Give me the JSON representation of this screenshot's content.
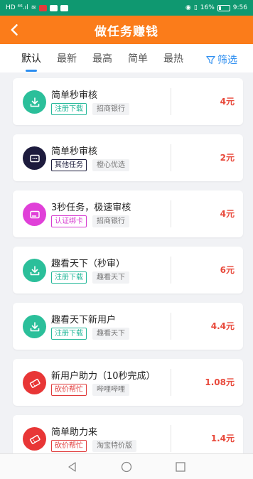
{
  "status_bar": {
    "left_text": "HD ⁴⁶.ıl",
    "battery_percent": "16%",
    "time": "9:56"
  },
  "header": {
    "back_icon": "chevron-left-icon",
    "title": "做任务赚钱"
  },
  "tabs": [
    {
      "label": "默认",
      "active": true
    },
    {
      "label": "最新",
      "active": false
    },
    {
      "label": "最高",
      "active": false
    },
    {
      "label": "简单",
      "active": false
    },
    {
      "label": "最热",
      "active": false
    }
  ],
  "filter": {
    "label": "筛选",
    "icon": "filter-icon"
  },
  "tasks": [
    {
      "title": "简单秒审核",
      "tag": "注册下载",
      "tag_color": "#25b89a",
      "source": "招商银行",
      "price": "4元",
      "icon": "download-icon",
      "icon_bg": "#2bbf9a"
    },
    {
      "title": "简单秒审核",
      "tag": "其他任务",
      "tag_color": "#1a1a3a",
      "source": "橙心优选",
      "price": "2元",
      "icon": "message-icon",
      "icon_bg": "#1d1b3d"
    },
    {
      "title": "3秒任务，极速审核",
      "tag": "认证绑卡",
      "tag_color": "#d63bd0",
      "source": "招商银行",
      "price": "4元",
      "icon": "card-icon",
      "icon_bg": "#e040d8"
    },
    {
      "title": "趣看天下（秒审）",
      "tag": "注册下载",
      "tag_color": "#25b89a",
      "source": "趣看天下",
      "price": "6元",
      "icon": "download-icon",
      "icon_bg": "#2bbf9a"
    },
    {
      "title": "趣看天下新用户",
      "tag": "注册下载",
      "tag_color": "#25b89a",
      "source": "趣看天下",
      "price": "4.4元",
      "icon": "download-icon",
      "icon_bg": "#2bbf9a"
    },
    {
      "title": "新用户助力（10秒完成）",
      "tag": "砍价帮忙",
      "tag_color": "#e03b3b",
      "source": "哔哩哔哩",
      "price": "1.08元",
      "icon": "coupon-icon",
      "icon_bg": "#e83636"
    },
    {
      "title": "简单助力来",
      "tag": "砍价帮忙",
      "tag_color": "#e03b3b",
      "source": "淘宝特价版",
      "price": "1.4元",
      "icon": "coupon-icon",
      "icon_bg": "#e83636"
    }
  ],
  "nav": {
    "back_icon": "triangle-back-icon",
    "home_icon": "circle-home-icon",
    "recent_icon": "square-recent-icon"
  }
}
